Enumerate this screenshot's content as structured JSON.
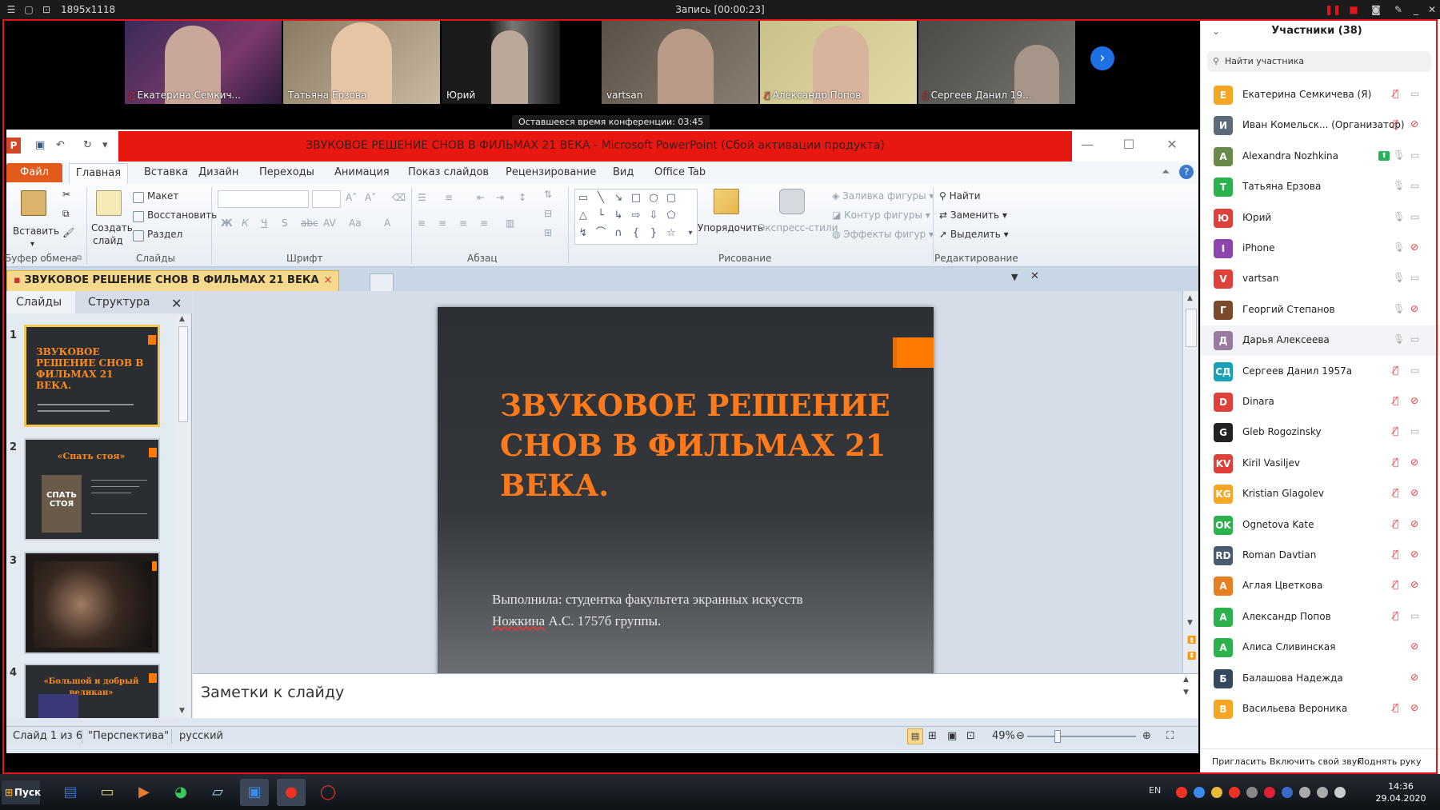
{
  "recorder": {
    "size_label": "1895x1118",
    "title": "Запись [00:00:23]"
  },
  "video_strip": {
    "tiles": [
      {
        "name": "Екатерина Семкич...",
        "muted": true
      },
      {
        "name": "Татьяна Ерзова",
        "muted": false
      },
      {
        "name": "Юрий",
        "muted": false
      },
      {
        "name": "vartsan",
        "muted": false
      },
      {
        "name": "Александр Попов",
        "muted": true
      },
      {
        "name": "Сергеев Данил 19...",
        "muted": true
      }
    ],
    "time_left": "Оставшееся время конференции: 03:45"
  },
  "ppt": {
    "window_title": "ЗВУКОВОЕ РЕШЕНИЕ СНОВ В ФИЛЬМАХ 21 ВЕКА - Microsoft PowerPoint (Сбой активации продукта)",
    "tabs": {
      "file": "Файл",
      "home": "Главная",
      "insert": "Вставка",
      "design": "Дизайн",
      "transitions": "Переходы",
      "animation": "Анимация",
      "slideshow": "Показ слайдов",
      "review": "Рецензирование",
      "view": "Вид",
      "officetab": "Office Tab"
    },
    "ribbon": {
      "paste": "Вставить",
      "clipboard_group": "Буфер обмена",
      "new_slide_1": "Создать",
      "new_slide_2": "слайд",
      "layout": "Макет",
      "reset": "Восстановить",
      "section": "Раздел",
      "slides_group": "Слайды",
      "font_group": "Шрифт",
      "paragraph_group": "Абзац",
      "arrange": "Упорядочить",
      "quick_styles": "Экспресс-стили",
      "shape_fill": "Заливка фигуры",
      "shape_outline": "Контур фигуры",
      "shape_effects": "Эффекты фигур",
      "drawing_group": "Рисование",
      "find": "Найти",
      "replace": "Заменить",
      "select": "Выделить",
      "editing_group": "Редактирование"
    },
    "doc_tab": "ЗВУКОВОЕ РЕШЕНИЕ СНОВ В ФИЛЬМАХ 21 ВЕКА",
    "panel": {
      "slides_tab": "Слайды",
      "outline_tab": "Структура",
      "thumbs": [
        {
          "num": "1",
          "title": "ЗВУКОВОЕ РЕШЕНИЕ СНОВ В ФИЛЬМАХ 21 ВЕКА."
        },
        {
          "num": "2",
          "title": "«Спать стоя»",
          "poster": "СПАТЬ СТОЯ"
        },
        {
          "num": "3"
        },
        {
          "num": "4",
          "title": "«Большой и добрый великан»"
        }
      ]
    },
    "slide": {
      "title": "ЗВУКОВОЕ РЕШЕНИЕ СНОВ В ФИЛЬМАХ 21 ВЕКА.",
      "subtitle_line1": "Выполнила: студентка факультета экранных искусств",
      "subtitle_name": "Ножкина",
      "subtitle_rest": " А.С. 1757б группы."
    },
    "notes_placeholder": "Заметки к слайду",
    "status": {
      "slide_of": "Слайд 1 из 6",
      "theme": "\"Перспектива\"",
      "language": "русский",
      "zoom": "49%"
    }
  },
  "participants": {
    "title": "Участники (38)",
    "search_placeholder": "Найти участника",
    "items": [
      {
        "initials": "Е",
        "color": "#f5a623",
        "name": "Екатерина Семкичева (Я)",
        "mic": "muted",
        "cam": "on"
      },
      {
        "initials": "И",
        "color": "#5b6b7a",
        "name": "Иван Комельск... (Организатор)",
        "mic": "muted",
        "cam": "muted"
      },
      {
        "initials": "A",
        "color": "#6a8a4a",
        "name": "Alexandra Nozhkina",
        "mic": "on",
        "cam": "on",
        "share": true
      },
      {
        "initials": "Т",
        "color": "#2bb24c",
        "name": "Татьяна Ерзова",
        "mic": "on",
        "cam": "on"
      },
      {
        "initials": "Ю",
        "color": "#e0403a",
        "name": "Юрий",
        "mic": "on",
        "cam": "on"
      },
      {
        "initials": "I",
        "color": "#8e44ad",
        "name": "iPhone",
        "mic": "on",
        "cam": "muted"
      },
      {
        "initials": "V",
        "color": "#e0403a",
        "name": "vartsan",
        "mic": "on",
        "cam": "on"
      },
      {
        "initials": "Г",
        "color": "#7a4a2a",
        "name": "Георгий Степанов",
        "mic": "on",
        "cam": "muted"
      },
      {
        "initials": "Д",
        "color": "#9a7aa0",
        "name": "Дарья Алексеева",
        "mic": "on",
        "cam": "on",
        "highlight": true
      },
      {
        "initials": "СД",
        "color": "#17a2b8",
        "name": "Сергеев Данил 1957a",
        "mic": "muted",
        "cam": "on"
      },
      {
        "initials": "D",
        "color": "#e0403a",
        "name": "Dinara",
        "mic": "muted",
        "cam": "muted"
      },
      {
        "initials": "G",
        "color": "#222222",
        "name": "Gleb Rogozinsky",
        "mic": "muted",
        "cam": "on"
      },
      {
        "initials": "KV",
        "color": "#e0403a",
        "name": "Kiril Vasiljev",
        "mic": "muted",
        "cam": "muted"
      },
      {
        "initials": "KG",
        "color": "#f5a623",
        "name": "Kristian Glagolev",
        "mic": "muted",
        "cam": "muted"
      },
      {
        "initials": "OK",
        "color": "#2bb24c",
        "name": "Ognetova Kate",
        "mic": "muted",
        "cam": "muted"
      },
      {
        "initials": "RD",
        "color": "#4a5a70",
        "name": "Roman Davtian",
        "mic": "muted",
        "cam": "muted"
      },
      {
        "initials": "А",
        "color": "#e67e22",
        "name": "Аглая Цветкова",
        "mic": "muted",
        "cam": "muted"
      },
      {
        "initials": "А",
        "color": "#2bb24c",
        "name": "Александр Попов",
        "mic": "muted",
        "cam": "on"
      },
      {
        "initials": "А",
        "color": "#2bb24c",
        "name": "Алиса Сливинская",
        "mic": "",
        "cam": "muted"
      },
      {
        "initials": "Б",
        "color": "#34495e",
        "name": "Балашова Надежда",
        "mic": "",
        "cam": "muted"
      },
      {
        "initials": "В",
        "color": "#f5a623",
        "name": "Васильева Вероника",
        "mic": "muted",
        "cam": "muted"
      }
    ],
    "footer": {
      "invite": "Пригласить",
      "unmute": "Включить свой звук",
      "raise": "Поднять руку"
    }
  },
  "taskbar": {
    "start": "Пуск",
    "lang": "EN",
    "time": "14:36",
    "date": "29.04.2020"
  }
}
